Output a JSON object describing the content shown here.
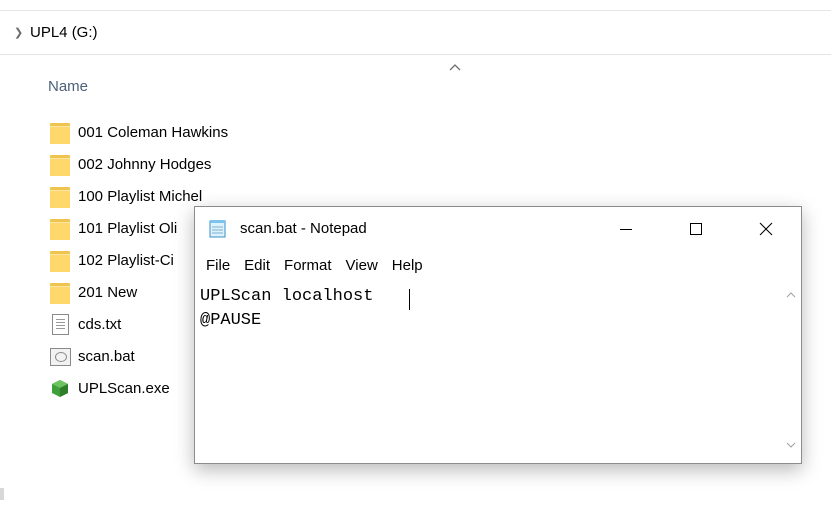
{
  "explorer": {
    "address_path": "UPL4 (G:)",
    "column_header": "Name",
    "items": [
      {
        "label": "001 Coleman Hawkins",
        "type": "folder"
      },
      {
        "label": "002 Johnny Hodges",
        "type": "folder"
      },
      {
        "label": "100 Playlist Michel",
        "type": "folder"
      },
      {
        "label": "101 Playlist Oli",
        "type": "folder"
      },
      {
        "label": "102 Playlist-Ci",
        "type": "folder"
      },
      {
        "label": "201 New",
        "type": "folder"
      },
      {
        "label": "cds.txt",
        "type": "text-file"
      },
      {
        "label": "scan.bat",
        "type": "batch-file"
      },
      {
        "label": "UPLScan.exe",
        "type": "executable"
      }
    ]
  },
  "notepad": {
    "title": "scan.bat - Notepad",
    "menu": [
      "File",
      "Edit",
      "Format",
      "View",
      "Help"
    ],
    "content": "UPLScan localhost\n@PAUSE"
  },
  "colors": {
    "folder": "#ffd86b",
    "header_text": "#4c607a",
    "exe_icon": "#3f9f3a"
  }
}
